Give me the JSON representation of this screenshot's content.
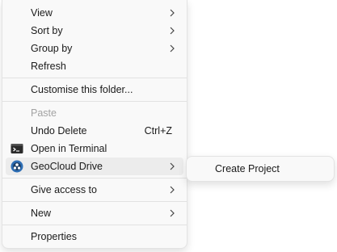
{
  "context_menu": {
    "view": "View",
    "sort_by": "Sort by",
    "group_by": "Group by",
    "refresh": "Refresh",
    "customise": "Customise this folder...",
    "paste": "Paste",
    "undo_delete": "Undo Delete",
    "undo_shortcut": "Ctrl+Z",
    "open_terminal": "Open in Terminal",
    "geocloud_drive": "GeoCloud Drive",
    "give_access": "Give access to",
    "new": "New",
    "properties": "Properties"
  },
  "submenu": {
    "create_project": "Create Project"
  },
  "icons": {
    "terminal": "terminal-icon",
    "geocloud": "geocloud-drive-icon",
    "chevron": "chevron-right-icon"
  },
  "colors": {
    "menu_bg": "#f9f9f9",
    "hover_bg": "#ececec",
    "geocloud_blue": "#2f6fb5",
    "disabled_text": "#a2a2a2"
  }
}
